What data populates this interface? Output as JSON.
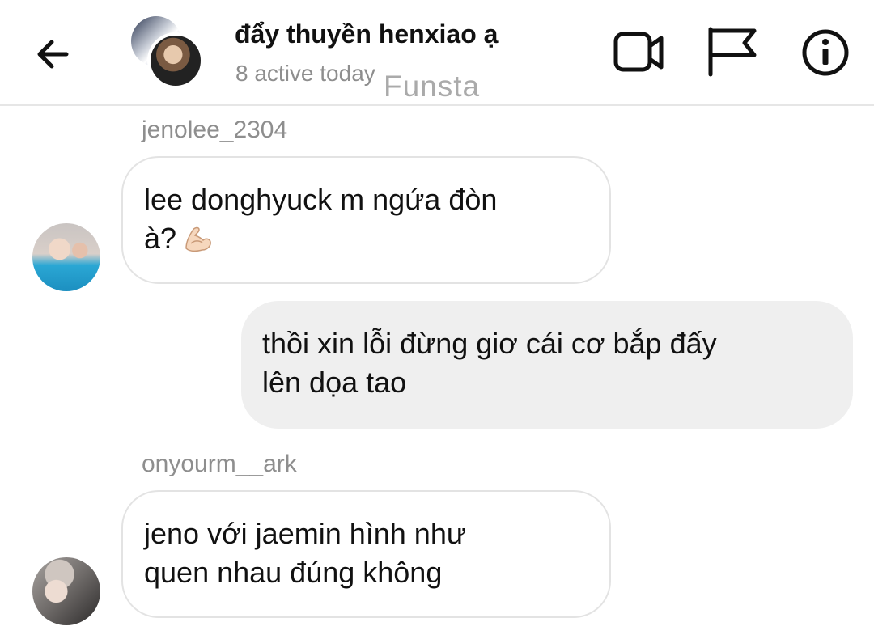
{
  "header": {
    "title": "đẩy thuyền henxiao ạ",
    "subtitle": "8 active today",
    "watermark": "Funsta"
  },
  "icons": {
    "back": "arrow-left-icon",
    "video": "video-call-icon",
    "flag": "flag-icon",
    "info": "info-icon",
    "emoji": "flexed-biceps-emoji"
  },
  "messages": [
    {
      "sender": "jenolee_2304",
      "lines": [
        "lee donghyuck m ngứa đòn",
        "à?"
      ],
      "emoji": "💪",
      "direction": "incoming"
    },
    {
      "sender": "",
      "lines": [
        "thồi xin lỗi đừng giơ cái cơ bắp đấy",
        "lên dọa tao"
      ],
      "direction": "outgoing"
    },
    {
      "sender": "onyourm__ark",
      "lines": [
        "jeno với jaemin hình như",
        "quen nhau đúng không"
      ],
      "direction": "incoming"
    }
  ],
  "colors": {
    "outgoing_bubble": "#efefef",
    "incoming_border": "#e3e3e3",
    "muted_text": "#8e8e8e"
  }
}
